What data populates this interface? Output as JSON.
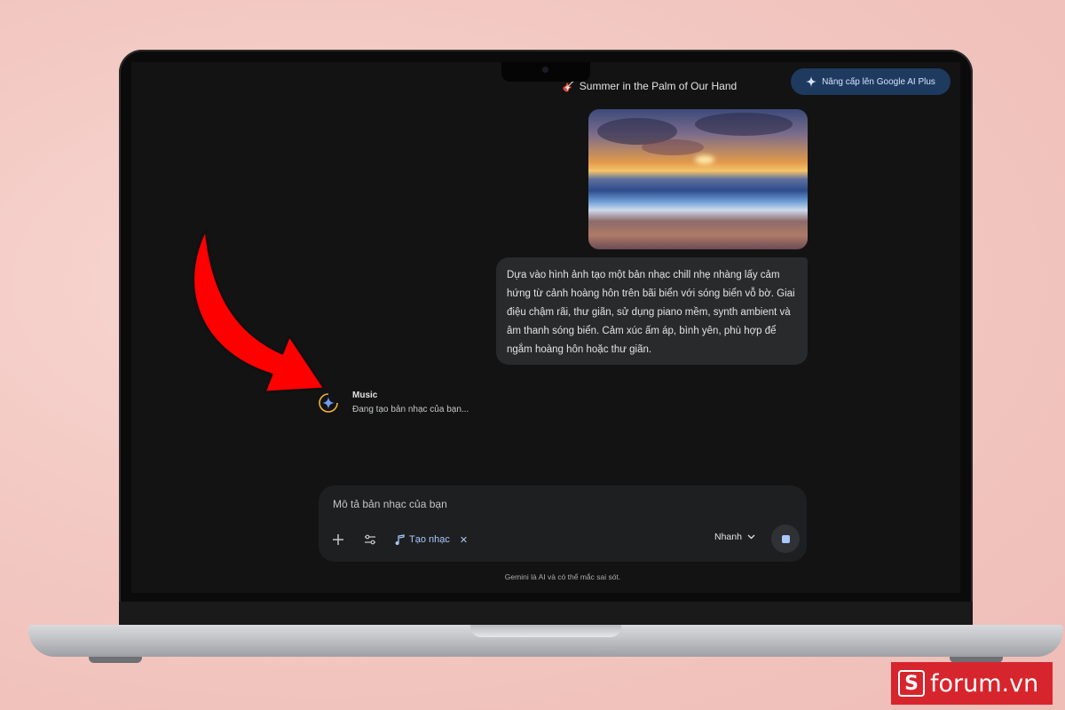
{
  "header": {
    "title": "Summer in the Palm of Our Hand",
    "upgrade_label": "Nâng cấp lên Google AI Plus"
  },
  "conversation": {
    "user_prompt": "Dựa vào hình ảnh tạo một bản nhạc chill nhẹ nhàng lấy cảm hứng từ cảnh hoàng hôn trên bãi biển với sóng biển vỗ bờ. Giai điệu chậm rãi, thư giãn, sử dụng piano mềm, synth ambient và âm thanh sóng biển. Cảm xúc ấm áp, bình yên, phù hợp để ngắm hoàng hôn hoặc thư giãn.",
    "response": {
      "title": "Music",
      "status": "Đang tạo bản nhạc của bạn..."
    }
  },
  "composer": {
    "placeholder": "Mô tả bản nhạc của bạn",
    "chip_label": "Tạo nhạc",
    "mode_label": "Nhanh"
  },
  "disclaimer": "Gemini là AI và có thể mắc sai sót.",
  "watermark": {
    "logo_letter": "S",
    "text": "forum.vn"
  },
  "colors": {
    "background": "#131314",
    "bubble": "#282a2c",
    "accent_blue": "#a8c7fa",
    "upgrade_bg": "#1e3a5f",
    "arrow_red": "#ff0000",
    "watermark_red": "#d7252d"
  }
}
